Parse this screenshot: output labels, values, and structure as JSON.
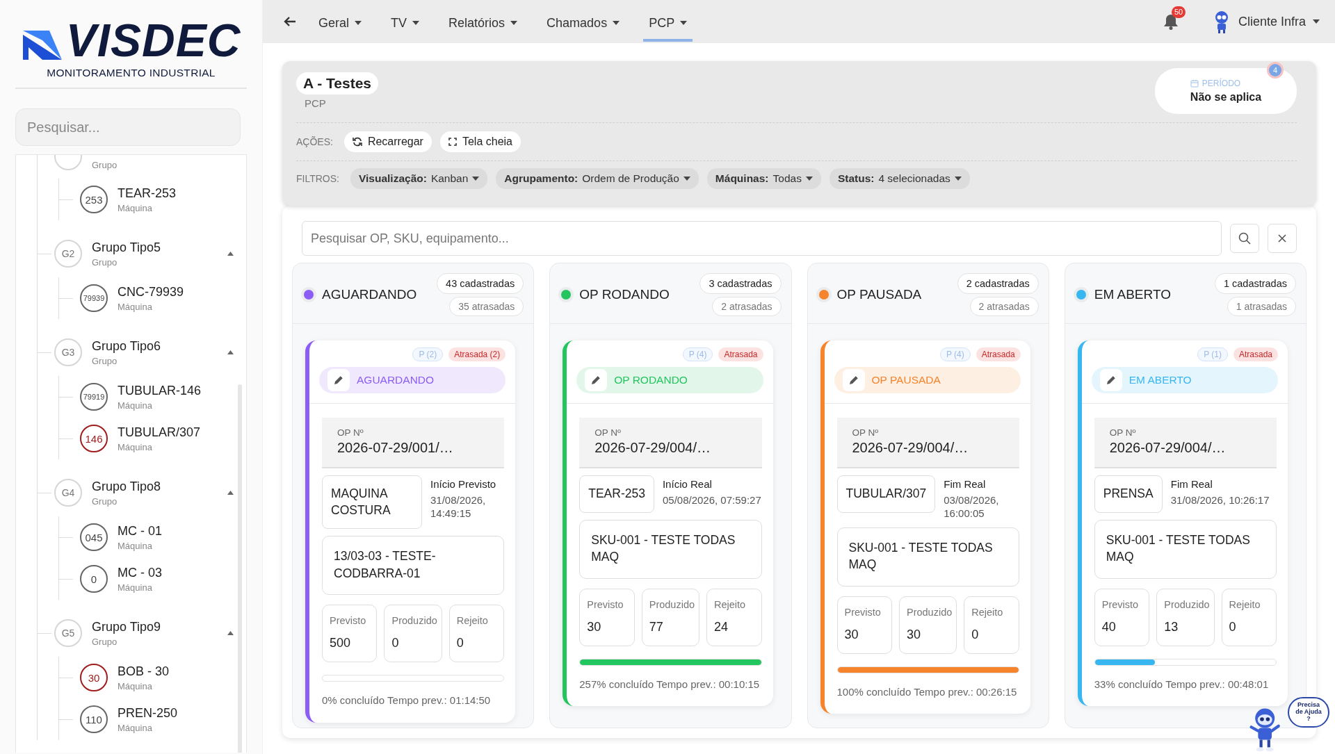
{
  "sidebar": {
    "logo": {
      "name": "VISDEC",
      "tagline": "MONITORAMENTO INDUSTRIAL"
    },
    "search": {
      "placeholder": "Pesquisar..."
    },
    "tree": [
      {
        "kind": "partial-group",
        "subtitle": "Grupo",
        "children": [
          {
            "kind": "machine",
            "badge": "253",
            "title": "TEAR-253",
            "subtitle": "Máquina",
            "alert": false
          }
        ]
      },
      {
        "kind": "group",
        "badge": "G2",
        "title": "Grupo Tipo5",
        "subtitle": "Grupo",
        "expanded": true,
        "children": [
          {
            "kind": "machine",
            "badge": "79939",
            "title": "CNC-79939",
            "subtitle": "Máquina",
            "alert": false
          }
        ]
      },
      {
        "kind": "group",
        "badge": "G3",
        "title": "Grupo Tipo6",
        "subtitle": "Grupo",
        "expanded": true,
        "children": [
          {
            "kind": "machine",
            "badge": "79919",
            "title": "TUBULAR-146",
            "subtitle": "Máquina",
            "alert": false
          },
          {
            "kind": "machine",
            "badge": "146",
            "title": "TUBULAR/307",
            "subtitle": "Máquina",
            "alert": true
          }
        ]
      },
      {
        "kind": "group",
        "badge": "G4",
        "title": "Grupo Tipo8",
        "subtitle": "Grupo",
        "expanded": true,
        "children": [
          {
            "kind": "machine",
            "badge": "045",
            "title": "MC - 01",
            "subtitle": "Máquina",
            "alert": false
          },
          {
            "kind": "machine",
            "badge": "0",
            "title": "MC - 03",
            "subtitle": "Máquina",
            "alert": false
          }
        ]
      },
      {
        "kind": "group",
        "badge": "G5",
        "title": "Grupo Tipo9",
        "subtitle": "Grupo",
        "expanded": true,
        "children": [
          {
            "kind": "machine",
            "badge": "30",
            "title": "BOB - 30",
            "subtitle": "Máquina",
            "alert": true
          },
          {
            "kind": "machine",
            "badge": "110",
            "title": "PREN-250",
            "subtitle": "Máquina",
            "alert": false
          }
        ]
      }
    ]
  },
  "nav": {
    "items": [
      {
        "label": "Geral",
        "selected": false
      },
      {
        "label": "TV",
        "selected": false
      },
      {
        "label": "Relatórios",
        "selected": false
      },
      {
        "label": "Chamados",
        "selected": false
      },
      {
        "label": "PCP",
        "selected": true
      }
    ],
    "notifications": "50",
    "user": "Cliente Infra"
  },
  "header": {
    "title": "A - Testes",
    "subtitle": "PCP",
    "period": {
      "label": "PERÍODO",
      "value": "Não se aplica",
      "badge": "4"
    },
    "actions_label": "AÇÕES:",
    "actions": [
      {
        "kind": "reload",
        "label": "Recarregar"
      },
      {
        "kind": "fullscreen",
        "label": "Tela cheia"
      }
    ],
    "filters_label": "FILTROS:",
    "filters": [
      {
        "label": "Visualização:",
        "value": "Kanban"
      },
      {
        "label": "Agrupamento:",
        "value": "Ordem de Produção"
      },
      {
        "label": "Máquinas:",
        "value": "Todas"
      },
      {
        "label": "Status:",
        "value": "4 selecionadas"
      }
    ]
  },
  "search": {
    "placeholder": "Pesquisar OP, SKU, equipamento..."
  },
  "board": {
    "columns": [
      {
        "name": "AGUARDANDO",
        "color": "#8b5cf6",
        "registered": "43 cadastradas",
        "late": "35 atrasadas",
        "cards": [
          {
            "priority": "P (2)",
            "late_tag": "Atrasada (2)",
            "status": "AGUARDANDO",
            "op_label": "OP Nº",
            "op_number": "2026-07-29/001/…",
            "machine": "MAQUINA COSTURA",
            "date_label": "Início Previsto",
            "date": "31/08/2026, 14:49:15",
            "sku": "13/03-03 - TESTE-CODBARRA-01",
            "stats": [
              {
                "label": "Previsto",
                "value": "500"
              },
              {
                "label": "Produzido",
                "value": "0"
              },
              {
                "label": "Rejeito",
                "value": "0"
              }
            ],
            "level": 0,
            "progress": "0% concluído",
            "time": "Tempo prev.: 01:14:50"
          }
        ]
      },
      {
        "name": "OP RODANDO",
        "color": "#22c55e",
        "registered": "3 cadastradas",
        "late": "2 atrasadas",
        "cards": [
          {
            "priority": "P (4)",
            "late_tag": "Atrasada",
            "status": "OP RODANDO",
            "op_label": "OP Nº",
            "op_number": "2026-07-29/004/…",
            "machine": "TEAR-253",
            "date_label": "Início Real",
            "date": "05/08/2026, 07:59:27",
            "sku": "SKU-001 - TESTE TODAS MAQ",
            "stats": [
              {
                "label": "Previsto",
                "value": "30"
              },
              {
                "label": "Produzido",
                "value": "77"
              },
              {
                "label": "Rejeito",
                "value": "24"
              }
            ],
            "level": 1,
            "progress": "257% concluído",
            "time": "Tempo prev.: 00:10:15"
          }
        ]
      },
      {
        "name": "OP PAUSADA",
        "color": "#f5842c",
        "registered": "2 cadastradas",
        "late": "2 atrasadas",
        "cards": [
          {
            "priority": "P (4)",
            "late_tag": "Atrasada",
            "status": "OP PAUSADA",
            "op_label": "OP Nº",
            "op_number": "2026-07-29/004/…",
            "machine": "TUBULAR/307",
            "date_label": "Fim Real",
            "date": "03/08/2026, 16:00:05",
            "sku": "SKU-001 - TESTE TODAS MAQ",
            "stats": [
              {
                "label": "Previsto",
                "value": "30"
              },
              {
                "label": "Produzido",
                "value": "30"
              },
              {
                "label": "Rejeito",
                "value": "0"
              }
            ],
            "level": 1,
            "progress": "100% concluído",
            "time": "Tempo prev.: 00:26:15"
          }
        ]
      },
      {
        "name": "EM ABERTO",
        "color": "#38b6ef",
        "registered": "1 cadastradas",
        "late": "1 atrasadas",
        "cards": [
          {
            "priority": "P (1)",
            "late_tag": "Atrasada",
            "status": "EM ABERTO",
            "op_label": "OP Nº",
            "op_number": "2026-07-29/004/…",
            "machine": "PRENSA",
            "date_label": "Fim Real",
            "date": "31/08/2026, 10:26:17",
            "sku": "SKU-001 - TESTE TODAS MAQ",
            "stats": [
              {
                "label": "Previsto",
                "value": "40"
              },
              {
                "label": "Produzido",
                "value": "13"
              },
              {
                "label": "Rejeito",
                "value": "0"
              }
            ],
            "level": 0.33,
            "progress": "33% concluído",
            "time": "Tempo prev.: 00:48:01"
          }
        ]
      }
    ]
  },
  "help": {
    "text": "Precisa de Ajuda ?"
  }
}
